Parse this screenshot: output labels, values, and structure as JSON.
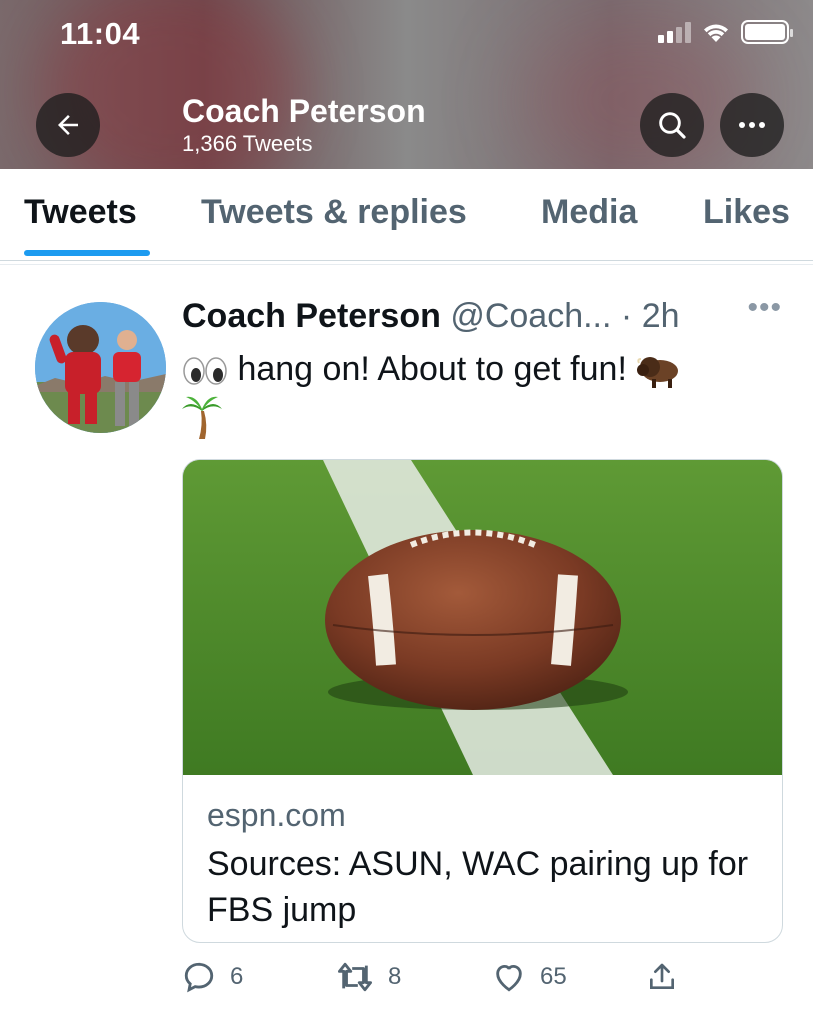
{
  "status_bar": {
    "time": "11:04"
  },
  "profile": {
    "name": "Coach Peterson",
    "tweet_count": "1,366 Tweets"
  },
  "tabs": [
    {
      "label": "Tweets",
      "active": true
    },
    {
      "label": "Tweets & replies",
      "active": false
    },
    {
      "label": "Media",
      "active": false
    },
    {
      "label": "Likes",
      "active": false
    }
  ],
  "tweet": {
    "author_name": "Coach Peterson",
    "handle": "@Coach...",
    "separator": "·",
    "time": "2h",
    "text": "hang on! About to get fun!",
    "emojis": [
      "eyes-emoji",
      "bison-emoji",
      "palm-tree-emoji"
    ],
    "card": {
      "domain": "espn.com",
      "title": "Sources: ASUN, WAC pairing up for FBS jump"
    },
    "actions": {
      "replies": "6",
      "retweets": "8",
      "likes": "65"
    }
  },
  "colors": {
    "accent": "#1d9bf0",
    "text_primary": "#0f1419",
    "text_secondary": "#536471"
  }
}
